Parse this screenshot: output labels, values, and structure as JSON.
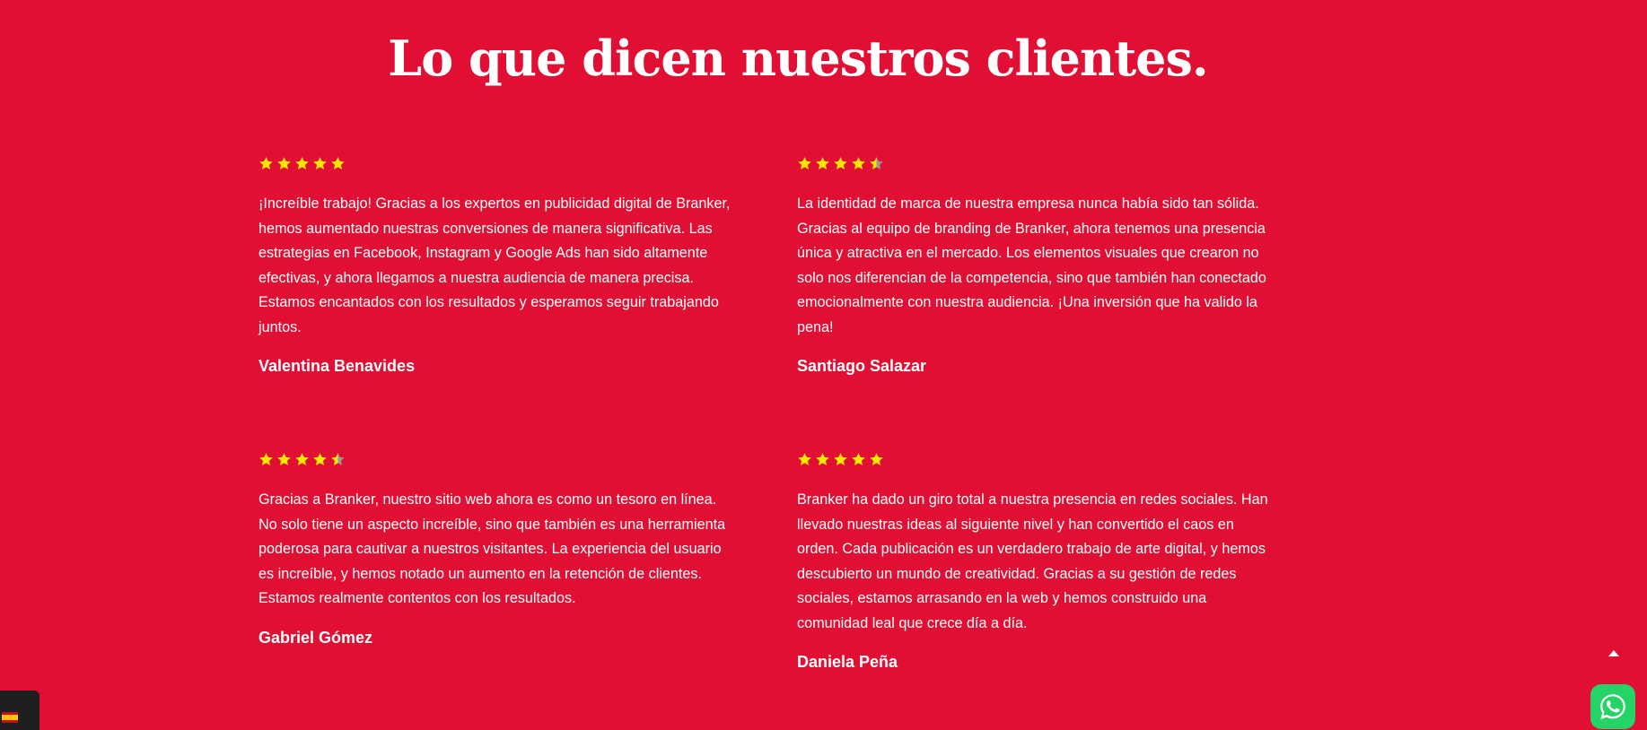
{
  "page": {
    "title": "Lo que dicen nuestros clientes."
  },
  "colors": {
    "background": "#e00f33",
    "text": "#ffffff",
    "star_fill": "#ffe600",
    "star_empty": "#9a9a9a",
    "whatsapp": "#25d366"
  },
  "testimonials": [
    {
      "rating": 5,
      "quote": "¡Increíble trabajo! Gracias a los expertos en publicidad digital de Branker, hemos aumentado nuestras conversiones de manera significativa. Las estrategias en Facebook, Instagram y Google Ads han sido altamente efectivas, y ahora llegamos a nuestra audiencia de manera precisa. Estamos encantados con los resultados y esperamos seguir trabajando juntos.",
      "author": "Valentina Benavides"
    },
    {
      "rating": 4.5,
      "quote": "La identidad de marca de nuestra empresa nunca había sido tan sólida. Gracias al equipo de branding de Branker, ahora tenemos una presencia única y atractiva en el mercado. Los elementos visuales que crearon no solo nos diferencian de la competencia, sino que también han conectado emocionalmente con nuestra audiencia. ¡Una inversión que ha valido la pena!",
      "author": "Santiago Salazar"
    },
    {
      "rating": 4.5,
      "quote": "Gracias a Branker, nuestro sitio web ahora es como un tesoro en línea. No solo tiene un aspecto increíble, sino que también es una herramienta poderosa para cautivar a nuestros visitantes. La experiencia del usuario es increíble, y hemos notado un aumento en la retención de clientes. Estamos realmente contentos con los resultados.",
      "author": "Gabriel Gómez"
    },
    {
      "rating": 5,
      "quote": "Branker ha dado un giro total a nuestra presencia en redes sociales. Han llevado nuestras ideas al siguiente nivel y han convertido el caos en orden. Cada publicación es un verdadero trabajo de arte digital, y hemos descubierto un mundo de creatividad. Gracias a su gestión de redes sociales, estamos arrasando en la web y hemos construido una comunidad leal que crece día a día.",
      "author": "Daniela Peña"
    }
  ],
  "widgets": {
    "language_flag_icon": "spain-flag-icon",
    "scroll_top_icon": "arrow-up-icon",
    "whatsapp_icon": "whatsapp-icon"
  }
}
